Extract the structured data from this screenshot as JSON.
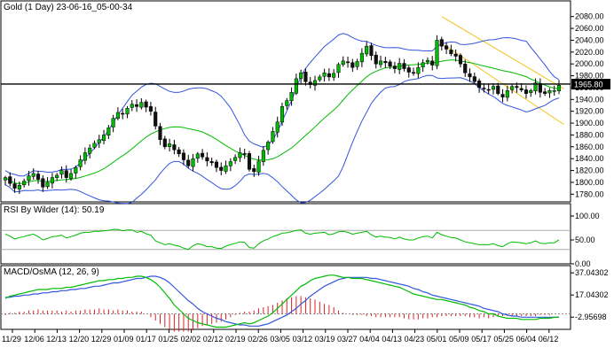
{
  "chart_data": [
    {
      "type": "candlestick",
      "panel": "price",
      "title": "Gold (1 Day) 23-06-16_05-00-34",
      "ylim": [
        1770,
        2090
      ],
      "y_ticks": [
        "2080.00",
        "2060.00",
        "2040.00",
        "2020.00",
        "2000.00",
        "1980.00",
        "1960.00",
        "1940.00",
        "1920.00",
        "1900.00",
        "1880.00",
        "1860.00",
        "1840.00",
        "1820.00",
        "1800.00",
        "1780.00"
      ],
      "last_price_label": "1965.80",
      "last_price": 1965.8,
      "horizontal_line": 1966,
      "x_labels": [
        "11/29",
        "12/06",
        "12/13",
        "12/20",
        "12/29",
        "01/09",
        "01/17",
        "01/25",
        "02/02",
        "02/12",
        "02/19",
        "02/26",
        "03/05",
        "03/12",
        "03/19",
        "03/27",
        "04/04",
        "04/13",
        "04/23",
        "05/01",
        "05/09",
        "05/17",
        "05/25",
        "06/04",
        "06/12"
      ],
      "close": [
        1808,
        1798,
        1790,
        1795,
        1802,
        1811,
        1815,
        1805,
        1792,
        1800,
        1808,
        1812,
        1820,
        1808,
        1815,
        1825,
        1838,
        1850,
        1858,
        1866,
        1872,
        1880,
        1892,
        1908,
        1918,
        1915,
        1925,
        1932,
        1928,
        1935,
        1927,
        1920,
        1895,
        1872,
        1860,
        1865,
        1855,
        1848,
        1838,
        1828,
        1840,
        1848,
        1843,
        1836,
        1833,
        1825,
        1820,
        1828,
        1835,
        1842,
        1850,
        1848,
        1822,
        1818,
        1836,
        1854,
        1868,
        1886,
        1902,
        1928,
        1938,
        1952,
        1975,
        1985,
        1970,
        1965,
        1972,
        1978,
        1985,
        1978,
        1984,
        1999,
        2005,
        2002,
        1994,
        2004,
        2018,
        2030,
        2014,
        2000,
        2005,
        2002,
        1996,
        1992,
        2001,
        1992,
        1986,
        1985,
        1994,
        2002,
        2006,
        1998,
        2040,
        2030,
        2025,
        2017,
        2013,
        2000,
        1985,
        1978,
        1970,
        1960,
        1958,
        1956,
        1962,
        1950,
        1944,
        1955,
        1962,
        1960,
        1956,
        1950,
        1955,
        1968,
        1952,
        1950,
        1955,
        1955,
        1964
      ],
      "moving_average": {
        "period": 20,
        "color": "#00bb00"
      },
      "bollinger_bands": {
        "period": 20,
        "stddev": 2,
        "color": "#3355dd"
      },
      "trend_channel": {
        "color": "#f2c420"
      }
    },
    {
      "type": "line",
      "panel": "rsi",
      "title": "RSI By Wilder (14): 50.19",
      "ylim": [
        0,
        100
      ],
      "y_ticks": [
        "100.00",
        "50.00",
        "0.00"
      ],
      "guide_levels": [
        30,
        70
      ],
      "series": [
        {
          "values": [
            62,
            58,
            52,
            55,
            57,
            60,
            62,
            57,
            50,
            53,
            57,
            58,
            60,
            54,
            57,
            60,
            64,
            66,
            66,
            68,
            68,
            69,
            70,
            72,
            72,
            69,
            71,
            71,
            66,
            68,
            63,
            60,
            48,
            44,
            40,
            42,
            39,
            37,
            33,
            30,
            38,
            42,
            40,
            36,
            36,
            33,
            32,
            37,
            40,
            43,
            46,
            45,
            34,
            33,
            42,
            48,
            52,
            57,
            60,
            64,
            65,
            67,
            70,
            71,
            64,
            62,
            64,
            65,
            66,
            61,
            63,
            67,
            68,
            66,
            62,
            64,
            66,
            68,
            61,
            56,
            58,
            56,
            55,
            52,
            56,
            52,
            50,
            50,
            54,
            57,
            58,
            54,
            66,
            61,
            58,
            55,
            54,
            50,
            46,
            44,
            42,
            40,
            40,
            40,
            42,
            38,
            36,
            42,
            46,
            45,
            44,
            42,
            44,
            48,
            43,
            42,
            44,
            44,
            50.19
          ]
        }
      ],
      "color": "#00bb00"
    },
    {
      "type": "line",
      "panel": "macd",
      "title": "MACD/OsMA (12, 26, 9)",
      "y_ticks": [
        "37.04302",
        "17.04302",
        "-2.95698"
      ],
      "ylim": [
        -14,
        42
      ],
      "zero_level": 0,
      "series": [
        {
          "values": [
            14,
            16,
            17,
            18,
            19,
            20,
            21,
            22,
            22,
            22,
            23,
            23,
            23,
            24,
            24,
            25,
            26,
            27,
            28,
            29,
            30,
            30,
            31,
            31,
            32,
            32,
            33,
            33,
            34,
            34,
            33,
            31,
            28,
            24,
            19,
            14,
            8,
            4,
            0,
            -4,
            -6,
            -8,
            -9,
            -10,
            -11,
            -12,
            -12,
            -12,
            -11,
            -10,
            -9,
            -8,
            -9,
            -8,
            -6,
            -4,
            -2,
            1,
            5,
            9,
            13,
            17,
            21,
            25,
            27,
            30,
            32,
            33,
            34,
            35,
            35,
            34,
            33,
            33,
            32,
            32,
            32,
            31,
            30,
            29,
            28,
            27,
            26,
            25,
            24,
            22,
            20,
            18,
            17,
            16,
            15,
            14,
            13,
            13,
            12,
            11,
            10,
            9,
            8,
            6,
            5,
            3,
            2,
            0,
            0,
            -2,
            -3,
            -4,
            -4,
            -4,
            -5,
            -5,
            -5,
            -5,
            -4,
            -4,
            -4,
            -3,
            -3
          ]
        },
        {
          "values": [
            15,
            15,
            16,
            16,
            17,
            17,
            18,
            18,
            19,
            19,
            20,
            20,
            21,
            21,
            22,
            22,
            23,
            23,
            24,
            25,
            25,
            26,
            27,
            28,
            28,
            29,
            30,
            31,
            32,
            32,
            33,
            34,
            34,
            33,
            31,
            28,
            24,
            20,
            16,
            12,
            9,
            5,
            2,
            0,
            -2,
            -4,
            -5,
            -7,
            -8,
            -9,
            -10,
            -10,
            -11,
            -11,
            -11,
            -10,
            -9,
            -7,
            -5,
            -3,
            -1,
            2,
            5,
            9,
            12,
            16,
            19,
            22,
            25,
            27,
            29,
            31,
            32,
            33,
            33,
            33,
            33,
            33,
            32,
            32,
            31,
            30,
            29,
            28,
            27,
            26,
            25,
            23,
            22,
            20,
            19,
            17,
            16,
            15,
            14,
            13,
            12,
            11,
            10,
            9,
            8,
            7,
            5,
            4,
            3,
            2,
            0,
            -1,
            -2,
            -2,
            -3,
            -3,
            -3,
            -3,
            -3,
            -3,
            -3,
            -3,
            -3
          ]
        }
      ],
      "histogram": [
        -1,
        1,
        1,
        2,
        2,
        3,
        3,
        4,
        3,
        3,
        3,
        3,
        2,
        3,
        2,
        3,
        3,
        4,
        4,
        4,
        5,
        4,
        4,
        3,
        4,
        3,
        3,
        2,
        2,
        2,
        0,
        -3,
        -6,
        -9,
        -12,
        -14,
        -16,
        -16,
        -16,
        -16,
        -15,
        -13,
        -11,
        -10,
        -9,
        -8,
        -7,
        -5,
        -3,
        -1,
        1,
        2,
        2,
        3,
        5,
        6,
        7,
        8,
        10,
        12,
        14,
        15,
        16,
        16,
        15,
        14,
        13,
        11,
        9,
        8,
        6,
        3,
        1,
        0,
        -1,
        -1,
        -1,
        -2,
        -2,
        -3,
        -3,
        -3,
        -3,
        -3,
        -3,
        -4,
        -5,
        -5,
        -5,
        -4,
        -4,
        -3,
        -3,
        -2,
        -2,
        -2,
        -2,
        -2,
        -2,
        -3,
        -3,
        -4,
        -3,
        -4,
        -3,
        -2,
        -2,
        -2,
        -2,
        -2,
        -2,
        -2,
        -2,
        -2,
        -1,
        -1,
        -1,
        0,
        0
      ],
      "colors": {
        "macd": "#00bb00",
        "signal": "#3355dd",
        "histogram": "#dd2222"
      }
    }
  ]
}
